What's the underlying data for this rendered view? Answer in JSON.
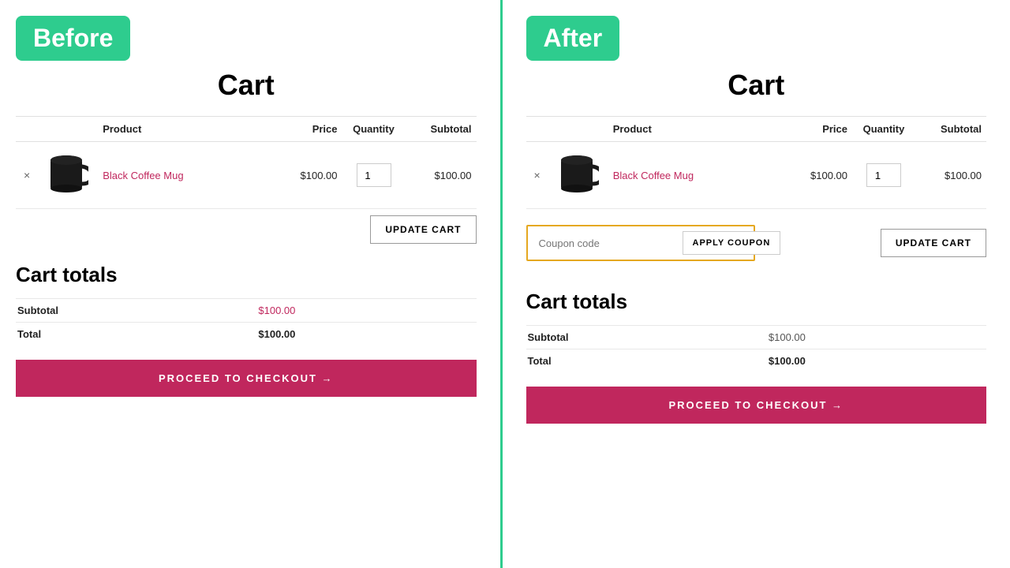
{
  "before": {
    "badge": "Before",
    "cart_title": "Cart",
    "table": {
      "headers": [
        "Product",
        "Price",
        "Quantity",
        "Subtotal"
      ],
      "row": {
        "product_name": "Black Coffee Mug",
        "price": "$100.00",
        "qty": "1",
        "subtotal": "$100.00"
      }
    },
    "update_cart_label": "UPDATE CART",
    "cart_totals_title": "Cart totals",
    "totals": {
      "subtotal_label": "Subtotal",
      "subtotal_value": "$100.00",
      "total_label": "Total",
      "total_value": "$100.00"
    },
    "checkout_label": "PROCEED TO CHECKOUT →"
  },
  "after": {
    "badge": "After",
    "cart_title": "Cart",
    "table": {
      "headers": [
        "Product",
        "Price",
        "Quantity",
        "Subtotal"
      ],
      "row": {
        "product_name": "Black Coffee Mug",
        "price": "$100.00",
        "qty": "1",
        "subtotal": "$100.00"
      }
    },
    "coupon": {
      "placeholder": "Coupon code",
      "apply_label": "APPLY COUPON"
    },
    "update_cart_label": "UPDATE CART",
    "cart_totals_title": "Cart totals",
    "totals": {
      "subtotal_label": "Subtotal",
      "subtotal_value": "$100.00",
      "total_label": "Total",
      "total_value": "$100.00"
    },
    "checkout_label": "PROCEED TO CHECKOUT →"
  },
  "divider_color": "#2ecc8e",
  "badge_color": "#2ecc8e",
  "link_color": "#c0275d",
  "checkout_bg": "#c0275d"
}
